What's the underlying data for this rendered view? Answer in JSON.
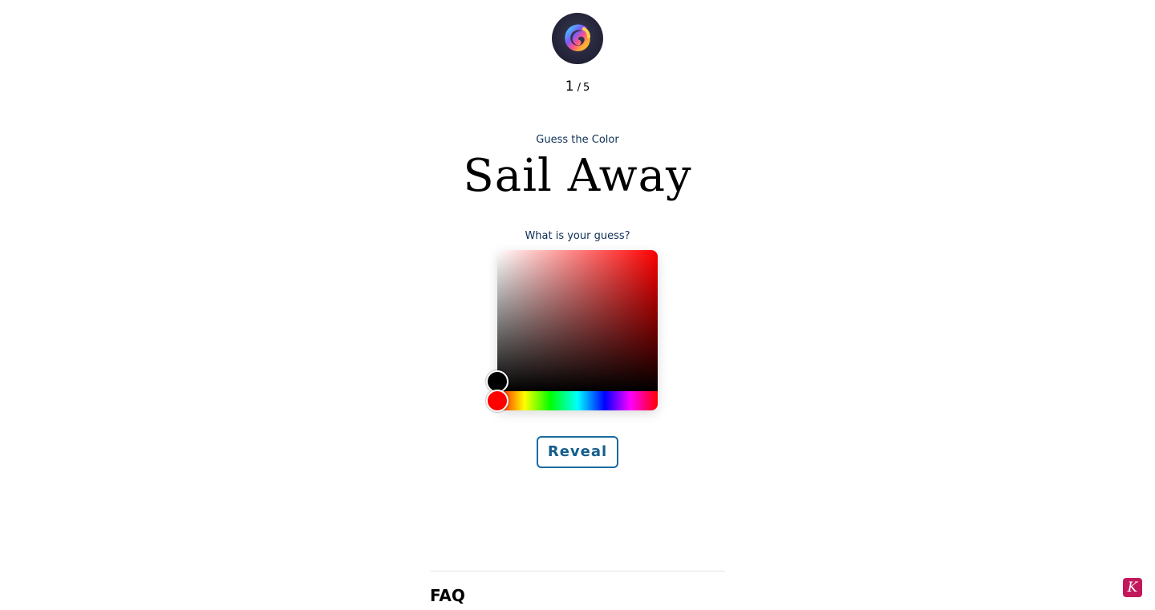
{
  "header": {
    "logo_icon": "swirl-logo-icon",
    "progress": {
      "current": "1",
      "separator": "/",
      "total": "5"
    }
  },
  "game": {
    "kicker": "Guess the Color",
    "color_name": "Sail Away",
    "question": "What is your guess?",
    "picker": {
      "base_hue_color": "#ff0000",
      "selected_color": "#000000",
      "hue_handle_color": "#ff0000"
    },
    "reveal_label": "Reveal"
  },
  "footer": {
    "faq_heading": "FAQ"
  },
  "widget": {
    "icon": "k-badge-icon",
    "label": "K",
    "color": "#c2185b"
  },
  "colors": {
    "accent": "#1a6ba0",
    "text_muted": "#0d2f55"
  }
}
